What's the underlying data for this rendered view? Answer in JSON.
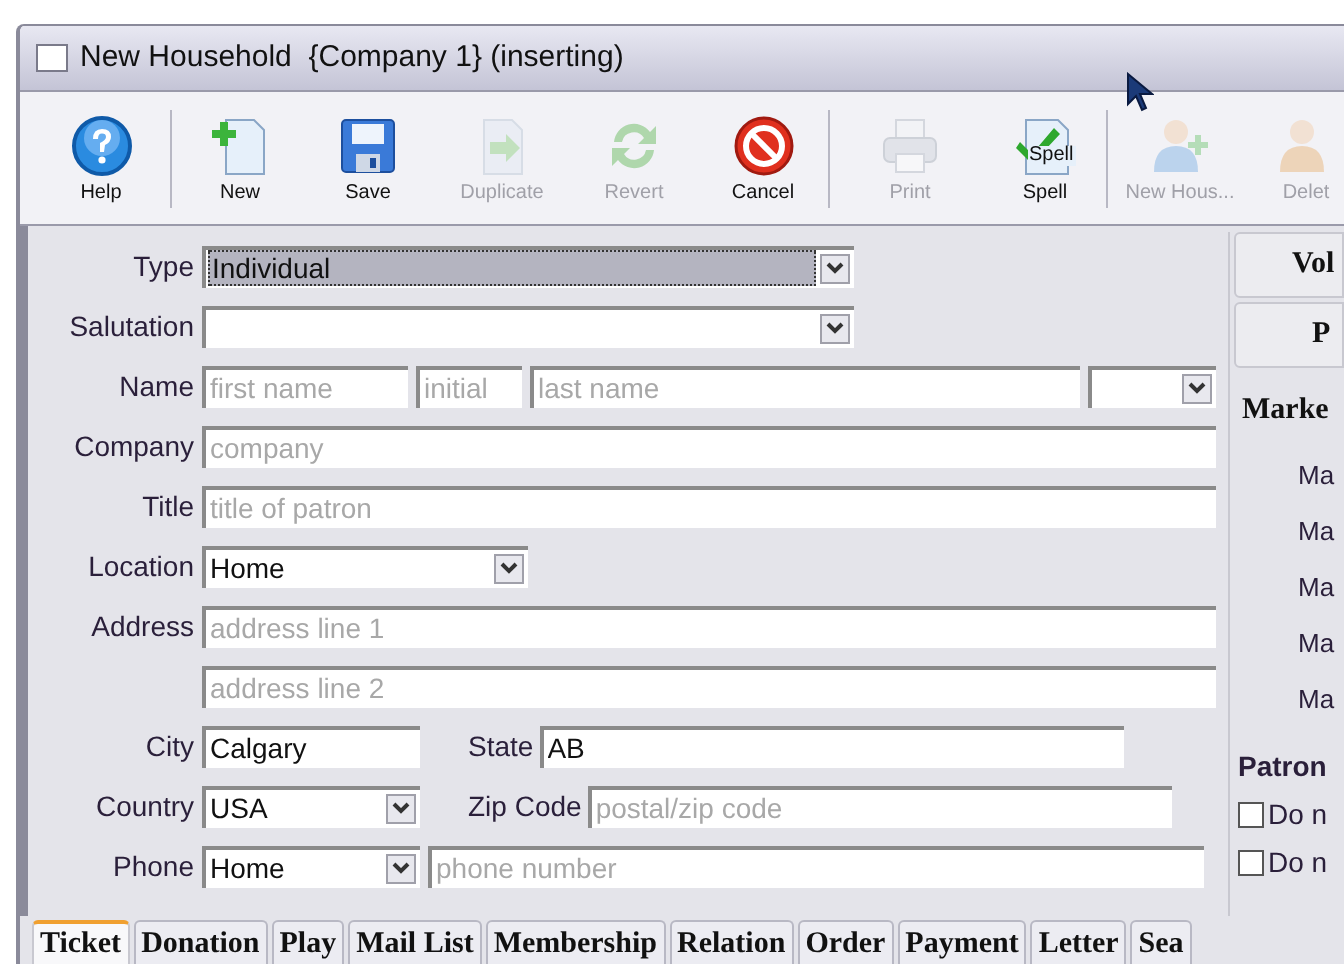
{
  "window": {
    "title": "New Household  {Company 1} (inserting)"
  },
  "toolbar": {
    "buttons": [
      {
        "label": "Help",
        "kind": "help",
        "disabled": false,
        "separator_after": true
      },
      {
        "label": "New",
        "kind": "new",
        "disabled": false,
        "separator_after": false
      },
      {
        "label": "Save",
        "kind": "save",
        "disabled": false,
        "separator_after": false
      },
      {
        "label": "Duplicate",
        "kind": "duplicate",
        "disabled": true,
        "separator_after": false
      },
      {
        "label": "Revert",
        "kind": "revert",
        "disabled": true,
        "separator_after": false
      },
      {
        "label": "Cancel",
        "kind": "cancel",
        "disabled": false,
        "separator_after": true
      },
      {
        "label": "Print",
        "kind": "print",
        "disabled": true,
        "separator_after": false
      },
      {
        "label": "Spell",
        "kind": "spell",
        "icon_text": "Spell",
        "disabled": false,
        "separator_after": true
      },
      {
        "label": "New Hous...",
        "kind": "person_add",
        "disabled": true,
        "separator_after": false
      },
      {
        "label": "Delet",
        "kind": "person",
        "disabled": true,
        "separator_after": false
      }
    ]
  },
  "form": {
    "rows": [
      {
        "label": "Type",
        "controls": [
          {
            "kind": "select",
            "value": "Individual",
            "focused": true
          }
        ]
      },
      {
        "label": "Salutation",
        "controls": [
          {
            "kind": "select",
            "focused": false
          }
        ]
      },
      {
        "label": "Name",
        "controls": [
          {
            "kind": "input",
            "placeholder": "first name"
          },
          {
            "kind": "input",
            "placeholder": "initial"
          },
          {
            "kind": "input",
            "placeholder": "last name"
          },
          {
            "kind": "select",
            "focused": false
          }
        ]
      },
      {
        "label": "Company",
        "controls": [
          {
            "kind": "input",
            "placeholder": "company"
          }
        ]
      },
      {
        "label": "Title",
        "controls": [
          {
            "kind": "input",
            "placeholder": "title of patron"
          }
        ]
      },
      {
        "label": "Location",
        "controls": [
          {
            "kind": "select",
            "value": "Home",
            "focused": false
          }
        ]
      },
      {
        "label": "Address",
        "controls": [
          {
            "kind": "input",
            "placeholder": "address line 1"
          }
        ]
      },
      {
        "controls": [
          {
            "kind": "input",
            "placeholder": "address line 2"
          }
        ]
      },
      {
        "label": "City",
        "controls": [
          {
            "kind": "input",
            "value": "Calgary"
          },
          {
            "kind": "input",
            "label": "State",
            "value": "AB"
          }
        ]
      },
      {
        "label": "Country",
        "controls": [
          {
            "kind": "select",
            "value": "USA",
            "focused": false
          },
          {
            "kind": "input",
            "label": "Zip Code",
            "placeholder": "postal/zip code"
          }
        ]
      },
      {
        "label": "Phone",
        "controls": [
          {
            "kind": "select",
            "value": "Home",
            "focused": false
          },
          {
            "kind": "input",
            "placeholder": "phone number"
          }
        ]
      }
    ]
  },
  "side_panel": {
    "buttons": [
      "Vol",
      "P"
    ],
    "section_title": "Marke",
    "items": [
      "Ma",
      "Ma",
      "Ma",
      "Ma",
      "Ma"
    ],
    "group_title": "Patron",
    "checkboxes": [
      {
        "label": "Do n",
        "checked": false
      },
      {
        "label": "Do n",
        "checked": false
      }
    ]
  },
  "tabs": [
    {
      "label": "Ticket",
      "selected": true
    },
    {
      "label": "Donation",
      "selected": false
    },
    {
      "label": "Play",
      "selected": false
    },
    {
      "label": "Mail List",
      "selected": false
    },
    {
      "label": "Membership",
      "selected": false
    },
    {
      "label": "Relation",
      "selected": false
    },
    {
      "label": "Order",
      "selected": false
    },
    {
      "label": "Payment",
      "selected": false
    },
    {
      "label": "Letter",
      "selected": false
    },
    {
      "label": "Sea",
      "selected": false
    }
  ]
}
